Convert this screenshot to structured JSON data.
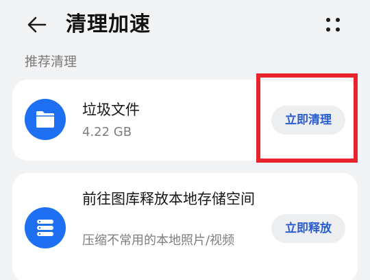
{
  "header": {
    "title": "清理加速",
    "back_icon": "back-arrow-icon",
    "more_icon": "more-dots-icon"
  },
  "section": {
    "label": "推荐清理"
  },
  "items": [
    {
      "title": "垃圾文件",
      "subtitle": "4.22 GB",
      "action": "立即清理",
      "icon": "folder-icon"
    },
    {
      "title": "前往图库释放本地存储空间",
      "subtitle": "压缩不常用的本地照片/视频",
      "action": "立即释放",
      "icon": "storage-icon"
    }
  ],
  "colors": {
    "background": "#f1f3f5",
    "card": "#ffffff",
    "accent": "#1e6ff1",
    "action_text": "#2a5cd1",
    "highlight": "#e8232d"
  }
}
